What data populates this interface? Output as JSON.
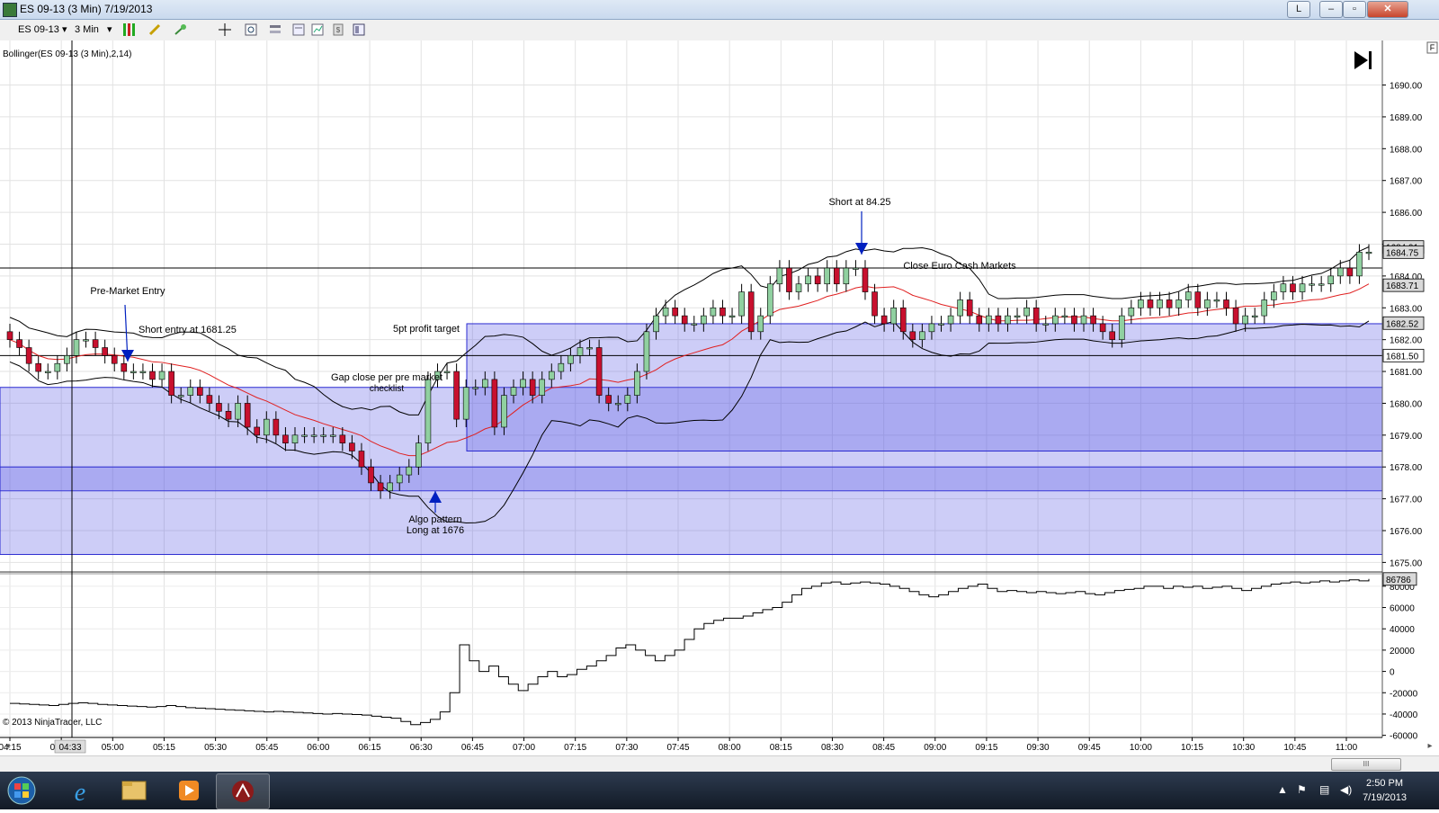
{
  "window": {
    "title": "ES 09-13 (3 Min)  7/19/2013",
    "btn_l": "L",
    "btn_min": "–",
    "btn_max": "▫",
    "btn_close": "✕"
  },
  "toolbar": {
    "instrument": "ES 09-13",
    "interval": "3 Min"
  },
  "indicator_label": "Bollinger(ES 09-13 (3 Min),2,14)",
  "copyright": "© 2013 NinjaTrader, LLC",
  "scroll_thumb": "III",
  "clock": {
    "time": "2:50 PM",
    "date": "7/19/2013"
  },
  "colors": {
    "up": "#90d0a0",
    "down": "#c8102e",
    "mid": "#e02020",
    "band": "#000000",
    "box": "rgba(90,90,230,0.30)",
    "boxline": "#2a2ad0"
  },
  "chart_data": {
    "type": "candlestick",
    "price_axis": {
      "ylim": [
        1674.7,
        1691.4
      ],
      "ticks": [
        "1675.00",
        "1676.00",
        "1677.00",
        "1678.00",
        "1679.00",
        "1680.00",
        "1681.00",
        "1682.00",
        "1683.00",
        "1684.00",
        "1685.00",
        "1686.00",
        "1687.00",
        "1688.00",
        "1689.00",
        "1690.00"
      ]
    },
    "time_axis": {
      "ticks": [
        "04:15",
        "04:45",
        "05:00",
        "05:15",
        "05:30",
        "05:45",
        "06:00",
        "06:15",
        "06:30",
        "06:45",
        "07:00",
        "07:15",
        "07:30",
        "07:45",
        "08:00",
        "08:15",
        "08:30",
        "08:45",
        "09:00",
        "09:15",
        "09:30",
        "09:45",
        "10:00",
        "10:15",
        "10:30",
        "10:45",
        "11:00"
      ],
      "cursor_label": "04:33"
    },
    "price_labels": [
      "1684.91",
      "1684.75",
      "1683.71",
      "1682.52",
      "1681.50"
    ],
    "closes": [
      1682,
      1681.75,
      1681.25,
      1681,
      1681,
      1681.25,
      1681.5,
      1682,
      1682,
      1681.75,
      1681.5,
      1681.25,
      1681,
      1681,
      1681,
      1680.75,
      1681,
      1680.25,
      1680.25,
      1680.5,
      1680.25,
      1680,
      1679.75,
      1679.5,
      1680,
      1679.25,
      1679,
      1679.5,
      1679,
      1678.75,
      1679,
      1679,
      1679,
      1679,
      1679,
      1678.75,
      1678.5,
      1678,
      1677.5,
      1677.25,
      1677.5,
      1677.75,
      1678,
      1678.75,
      1680.75,
      1681,
      1681,
      1679.5,
      1680.5,
      1680.5,
      1680.75,
      1679.25,
      1680.25,
      1680.5,
      1680.75,
      1680.25,
      1680.75,
      1681,
      1681.25,
      1681.5,
      1681.75,
      1681.75,
      1680.25,
      1680,
      1680,
      1680.25,
      1681,
      1682.25,
      1682.75,
      1683,
      1682.75,
      1682.5,
      1682.5,
      1682.75,
      1683,
      1682.75,
      1682.75,
      1683.5,
      1682.25,
      1682.75,
      1683.75,
      1684.25,
      1683.5,
      1683.75,
      1684,
      1683.75,
      1684.25,
      1683.75,
      1684.25,
      1684.25,
      1683.5,
      1682.75,
      1682.5,
      1683,
      1682.25,
      1682,
      1682.25,
      1682.5,
      1682.5,
      1682.75,
      1683.25,
      1682.75,
      1682.5,
      1682.75,
      1682.5,
      1682.75,
      1682.75,
      1683,
      1682.5,
      1682.5,
      1682.75,
      1682.75,
      1682.5,
      1682.75,
      1682.5,
      1682.25,
      1682,
      1682.75,
      1683,
      1683.25,
      1683,
      1683.25,
      1683,
      1683.25,
      1683.5,
      1683,
      1683.25,
      1683.25,
      1683,
      1682.5,
      1682.75,
      1682.75,
      1683.25,
      1683.5,
      1683.75,
      1683.5,
      1683.75,
      1683.75,
      1683.75,
      1684,
      1684.25,
      1684,
      1684.75,
      1684.75
    ],
    "box_zones": [
      {
        "label": "Gap close per pre market checklist",
        "from": 1677.25,
        "to": 1680.5
      },
      {
        "label": "Algo pattern zone",
        "from": 1675.25,
        "to": 1678.0
      },
      {
        "label": "5pt profit target",
        "from": 1678.5,
        "to": 1682.5
      }
    ],
    "levels": [
      1681.5,
      1684.25
    ],
    "annotations": [
      {
        "text": "Pre-Market Entry"
      },
      {
        "text": "Short entry at 1681.25"
      },
      {
        "text": "5pt profit target"
      },
      {
        "text": "Gap close per pre market"
      },
      {
        "text": "checklist"
      },
      {
        "text": "Algo pattern"
      },
      {
        "text": "Long at 1676"
      },
      {
        "text": "Short at 84.25"
      },
      {
        "text": "Close Euro Cash Markets"
      }
    ],
    "volume_axis": {
      "ylim": [
        -62000,
        90000
      ],
      "ticks": [
        "-60000",
        "-40000",
        "-20000",
        "0",
        "20000",
        "40000",
        "60000",
        "80000"
      ],
      "last_label": "86786"
    },
    "cumulative_values": [
      -30000,
      -30500,
      -31000,
      -31500,
      -32000,
      -31000,
      -30000,
      -29500,
      -30000,
      -31000,
      -31500,
      -32000,
      -32500,
      -33000,
      -33500,
      -33000,
      -32000,
      -33000,
      -34000,
      -34500,
      -35000,
      -35500,
      -36000,
      -36500,
      -37000,
      -37500,
      -38000,
      -37500,
      -38000,
      -38500,
      -39000,
      -39500,
      -40000,
      -39500,
      -40000,
      -40500,
      -41000,
      -42000,
      -43000,
      -44000,
      -47000,
      -50000,
      -48000,
      -45000,
      -38000,
      -20000,
      25000,
      10000,
      0,
      5000,
      -5000,
      -12000,
      -18000,
      -12000,
      -5000,
      0,
      -5000,
      -3000,
      2000,
      5000,
      10000,
      15000,
      22000,
      25000,
      20000,
      15000,
      10000,
      15000,
      20000,
      30000,
      40000,
      45000,
      48000,
      50000,
      50000,
      52000,
      55000,
      58000,
      60000,
      65000,
      72000,
      78000,
      80000,
      83000,
      84000,
      82000,
      83000,
      84000,
      83000,
      82000,
      80000,
      78000,
      75000,
      72000,
      70000,
      72000,
      75000,
      78000,
      80000,
      82000,
      78000,
      75000,
      76000,
      75000,
      74000,
      75000,
      74000,
      73000,
      74000,
      75000,
      73000,
      72000,
      74000,
      76000,
      77000,
      78000,
      80000,
      80000,
      78000,
      80000,
      79000,
      80000,
      78000,
      79000,
      80000,
      78000,
      76000,
      78000,
      80000,
      82000,
      83000,
      84000,
      83000,
      84000,
      85000,
      84000,
      85000,
      86000,
      85000,
      86786
    ]
  }
}
